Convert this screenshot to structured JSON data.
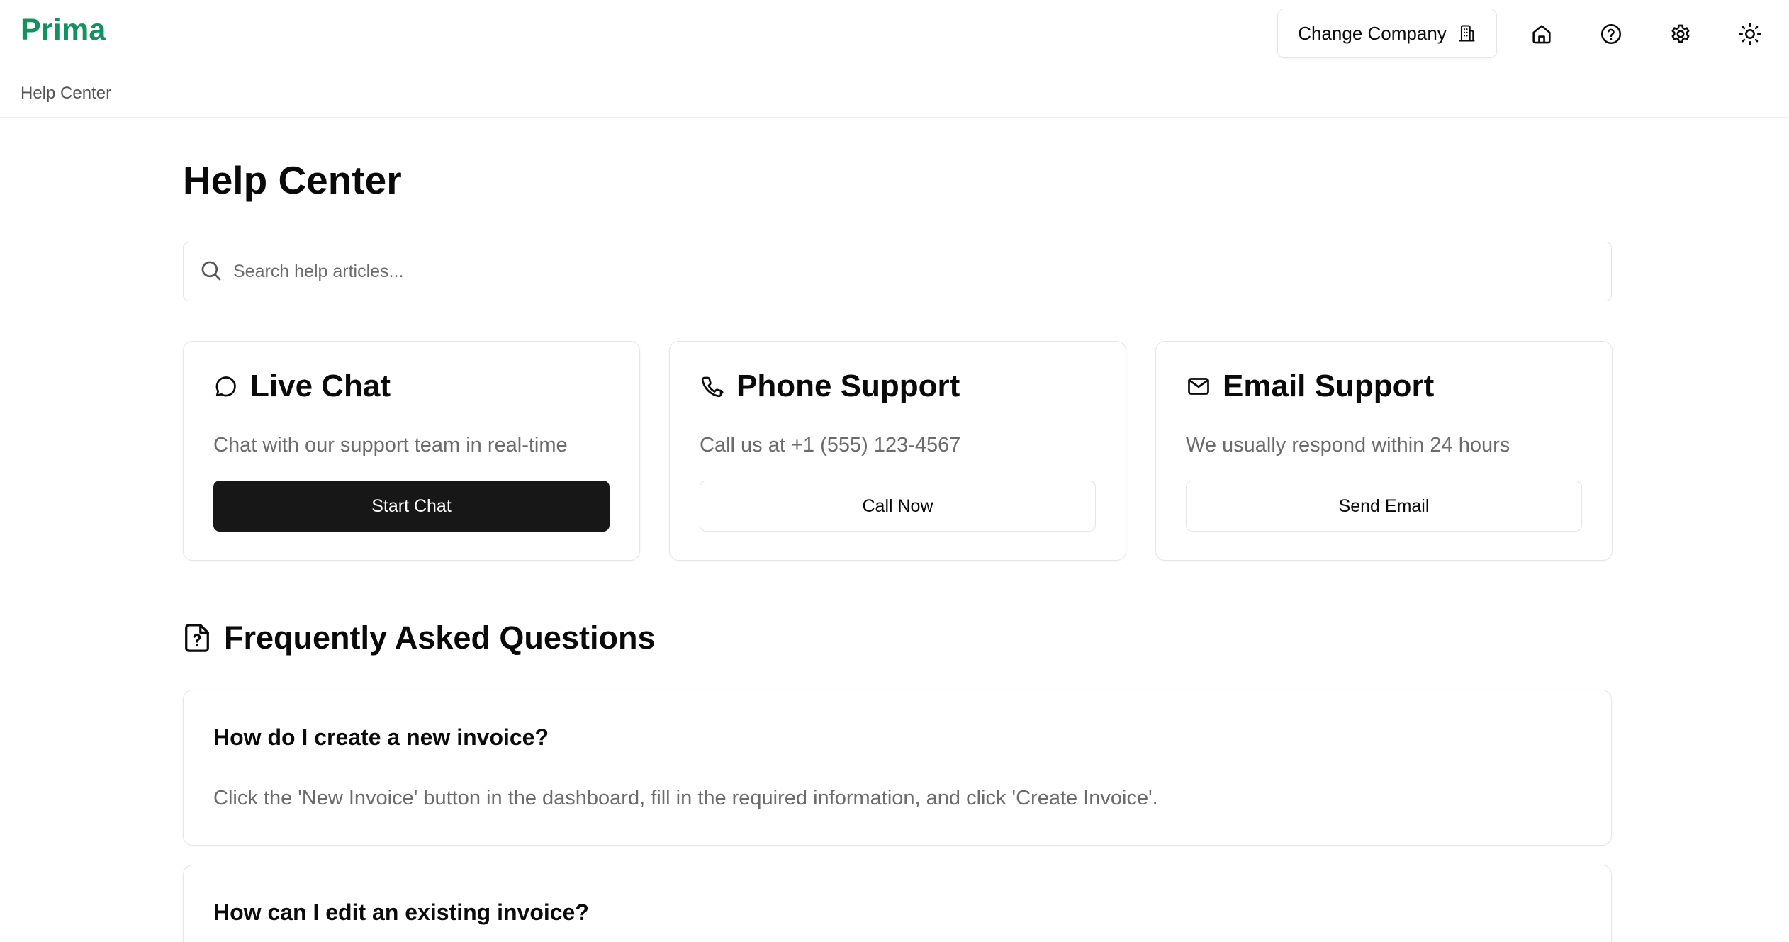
{
  "app": {
    "brand": "Prima"
  },
  "header": {
    "change_company_label": "Change Company",
    "icons": [
      "building-icon",
      "home-icon",
      "help-circle-icon",
      "gear-icon",
      "sun-icon"
    ]
  },
  "breadcrumb": {
    "current": "Help Center"
  },
  "page": {
    "title": "Help Center"
  },
  "search": {
    "placeholder": "Search help articles...",
    "value": ""
  },
  "support": [
    {
      "icon": "message-circle-icon",
      "title": "Live Chat",
      "description": "Chat with our support team in real-time",
      "button": "Start Chat"
    },
    {
      "icon": "phone-icon",
      "title": "Phone Support",
      "description": "Call us at +1 (555) 123-4567",
      "button": "Call Now"
    },
    {
      "icon": "mail-icon",
      "title": "Email Support",
      "description": "We usually respond within 24 hours",
      "button": "Send Email"
    }
  ],
  "faq": {
    "title": "Frequently Asked Questions",
    "items": [
      {
        "question": "How do I create a new invoice?",
        "answer": "Click the 'New Invoice' button in the dashboard, fill in the required information, and click 'Create Invoice'."
      },
      {
        "question": "How can I edit an existing invoice?",
        "answer": ""
      }
    ]
  },
  "colors": {
    "brand": "#12925f",
    "primary_button": "#171717",
    "muted_text": "#6b6b6b",
    "border": "#e5e5e5"
  }
}
